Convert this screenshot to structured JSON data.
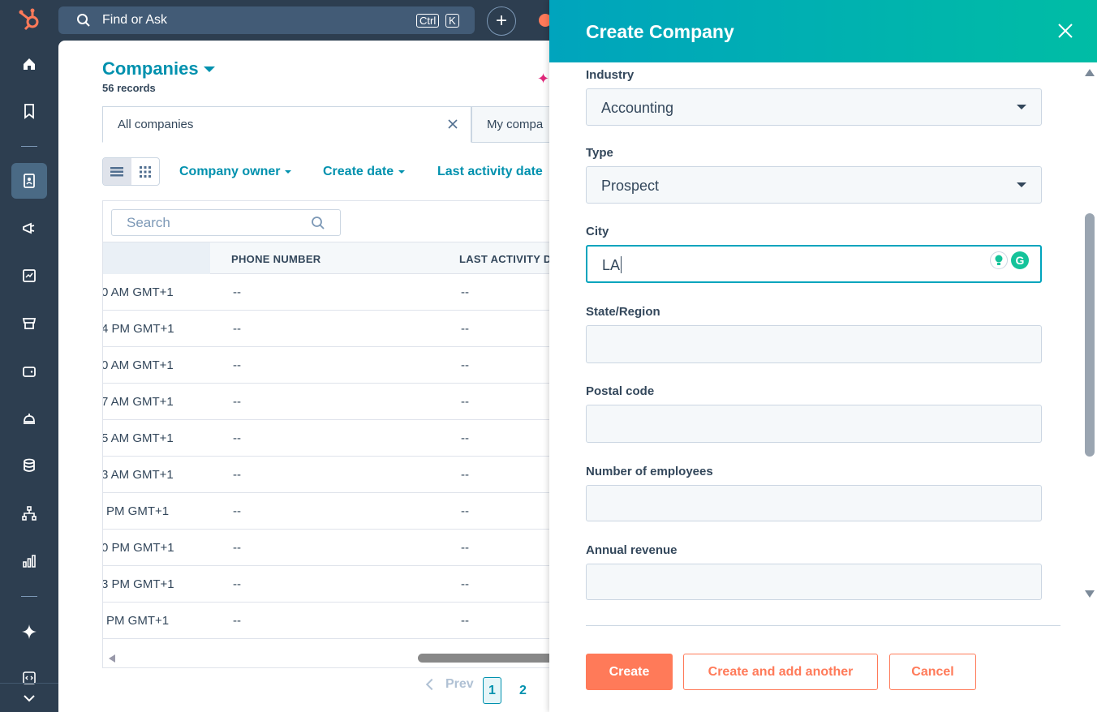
{
  "topbar": {
    "search_label": "Find or Ask",
    "kbd_ctrl": "Ctrl",
    "kbd_k": "K",
    "plus_label": "+"
  },
  "sidebar": {
    "items": [
      {
        "name": "home-icon"
      },
      {
        "name": "bookmark-icon"
      },
      {
        "name": "contacts-icon",
        "active": true
      },
      {
        "name": "megaphone-icon"
      },
      {
        "name": "content-icon"
      },
      {
        "name": "commerce-icon"
      },
      {
        "name": "wallet-icon"
      },
      {
        "name": "service-bell-icon"
      },
      {
        "name": "database-icon"
      },
      {
        "name": "org-chart-icon"
      },
      {
        "name": "reports-icon"
      },
      {
        "name": "ai-sparkle-icon"
      },
      {
        "name": "code-icon"
      }
    ]
  },
  "main": {
    "title": "Companies",
    "records": "56 records",
    "tabs": [
      {
        "label": "All companies"
      },
      {
        "label": "My compa"
      }
    ],
    "filters": [
      "Company owner",
      "Create date",
      "Last activity date"
    ],
    "table_search_placeholder": "Search",
    "columns": [
      "PHONE NUMBER",
      "LAST ACTIVITY D"
    ],
    "rows": [
      {
        "date": "0 AM GMT+1",
        "phone": "--",
        "last_activity": "--"
      },
      {
        "date": "4 PM GMT+1",
        "phone": "--",
        "last_activity": "--"
      },
      {
        "date": "0 AM GMT+1",
        "phone": "--",
        "last_activity": "--"
      },
      {
        "date": "7 AM GMT+1",
        "phone": "--",
        "last_activity": "--"
      },
      {
        "date": "5 AM GMT+1",
        "phone": "--",
        "last_activity": "--"
      },
      {
        "date": "3 AM GMT+1",
        "phone": "--",
        "last_activity": "--"
      },
      {
        "date": "PM GMT+1",
        "phone": "--",
        "last_activity": "--"
      },
      {
        "date": "0 PM GMT+1",
        "phone": "--",
        "last_activity": "--"
      },
      {
        "date": "3 PM GMT+1",
        "phone": "--",
        "last_activity": "--"
      },
      {
        "date": "PM GMT+1",
        "phone": "--",
        "last_activity": "--"
      }
    ],
    "pager": {
      "prev": "Prev",
      "current": "1",
      "next_page": "2"
    }
  },
  "panel": {
    "title": "Create Company",
    "fields": [
      {
        "label": "Industry",
        "value": "Accounting",
        "type": "select"
      },
      {
        "label": "Type",
        "value": "Prospect",
        "type": "select"
      },
      {
        "label": "City",
        "value": "LA",
        "type": "text",
        "focused": true
      },
      {
        "label": "State/Region",
        "value": "",
        "type": "text"
      },
      {
        "label": "Postal code",
        "value": "",
        "type": "text"
      },
      {
        "label": "Number of employees",
        "value": "",
        "type": "text"
      },
      {
        "label": "Annual revenue",
        "value": "",
        "type": "text"
      }
    ],
    "buttons": {
      "create": "Create",
      "create_another": "Create and add another",
      "cancel": "Cancel"
    }
  },
  "colors": {
    "accent": "#0091ae",
    "header_gradient_start": "#00a4bd",
    "header_gradient_end": "#00bda5",
    "primary_button": "#ff7a59",
    "nav_bg": "#2d3e50"
  }
}
